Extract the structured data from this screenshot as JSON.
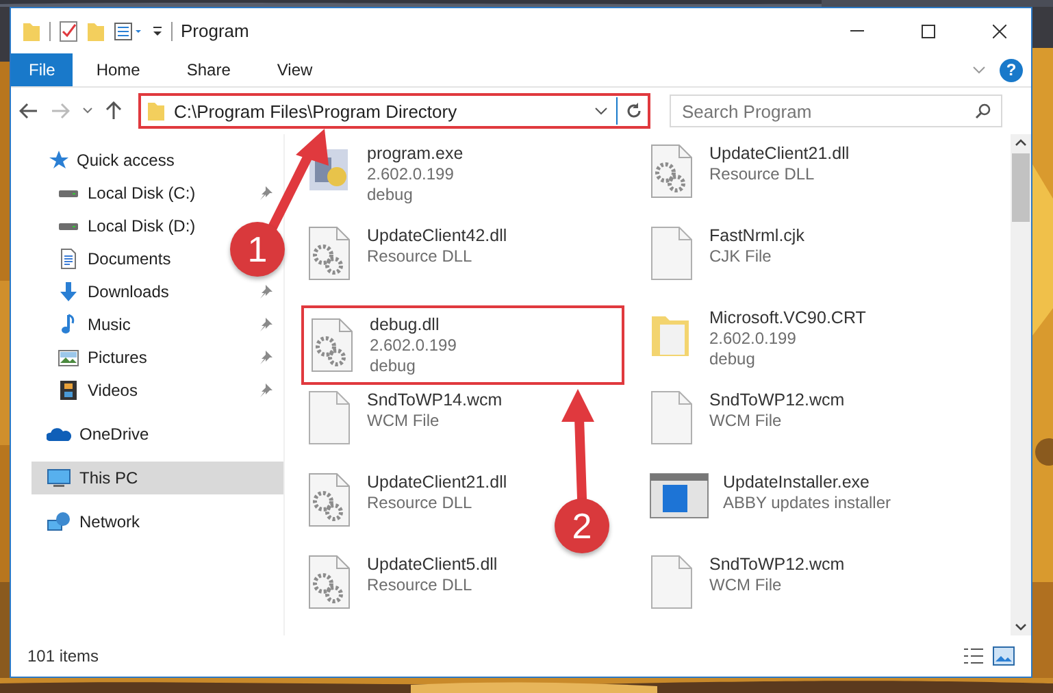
{
  "window": {
    "title": "Program"
  },
  "ribbon_tabs": [
    {
      "label": "File",
      "selected": true
    },
    {
      "label": "Home",
      "selected": false
    },
    {
      "label": "Share",
      "selected": false
    },
    {
      "label": "View",
      "selected": false
    }
  ],
  "help_button": "?",
  "address": {
    "path": "C:\\Program Files\\Program Directory",
    "highlighted": true
  },
  "search": {
    "placeholder": "Search Program"
  },
  "sidebar": {
    "items": [
      {
        "label": "Quick access",
        "kind": "star",
        "selected": false,
        "children": [
          {
            "label": "Local Disk (C:)",
            "kind": "drive",
            "pinned": true,
            "selected": false
          },
          {
            "label": "Local Disk (D:)",
            "kind": "drive",
            "pinned": false,
            "selected": false
          },
          {
            "label": "Documents",
            "kind": "documents",
            "pinned": false,
            "selected": false
          },
          {
            "label": "Downloads",
            "kind": "downloads",
            "pinned": true,
            "selected": false
          },
          {
            "label": "Music",
            "kind": "music",
            "pinned": true,
            "selected": false
          },
          {
            "label": "Pictures",
            "kind": "pictures",
            "pinned": true,
            "selected": false
          },
          {
            "label": "Videos",
            "kind": "videos",
            "pinned": true,
            "selected": false
          }
        ]
      },
      {
        "label": "OneDrive",
        "kind": "cloud",
        "selected": false
      },
      {
        "label": "This PC",
        "kind": "pc",
        "selected": true
      },
      {
        "label": "Network",
        "kind": "network",
        "selected": false
      }
    ]
  },
  "files": [
    {
      "name": "program.exe",
      "lines": [
        "2.602.0.199",
        "debug"
      ],
      "kind": "exe",
      "highlighted": false
    },
    {
      "name": "UpdateClient21.dll",
      "lines": [
        "Resource DLL"
      ],
      "kind": "dll",
      "highlighted": false
    },
    {
      "name": "UpdateClient42.dll",
      "lines": [
        "Resource DLL"
      ],
      "kind": "dll",
      "highlighted": false
    },
    {
      "name": "FastNrml.cjk",
      "lines": [
        "CJK File"
      ],
      "kind": "file",
      "highlighted": false
    },
    {
      "name": "debug.dll",
      "lines": [
        "2.602.0.199",
        "debug"
      ],
      "kind": "dll",
      "highlighted": true
    },
    {
      "name": "Microsoft.VC90.CRT",
      "lines": [
        "2.602.0.199",
        "debug"
      ],
      "kind": "folder",
      "highlighted": false
    },
    {
      "name": "SndToWP14.wcm",
      "lines": [
        "WCM File"
      ],
      "kind": "file",
      "highlighted": false
    },
    {
      "name": "SndToWP12.wcm",
      "lines": [
        "WCM File"
      ],
      "kind": "file",
      "highlighted": false
    },
    {
      "name": "UpdateClient21.dll",
      "lines": [
        "Resource DLL"
      ],
      "kind": "dll",
      "highlighted": false
    },
    {
      "name": "UpdateInstaller.exe",
      "lines": [
        "ABBY updates installer"
      ],
      "kind": "installer",
      "highlighted": false
    },
    {
      "name": "UpdateClient5.dll",
      "lines": [
        "Resource DLL"
      ],
      "kind": "dll",
      "highlighted": false
    },
    {
      "name": "SndToWP12.wcm",
      "lines": [
        "WCM File"
      ],
      "kind": "file",
      "highlighted": false
    }
  ],
  "status_bar": {
    "text": "101 items"
  },
  "annotations": [
    {
      "label": "1"
    },
    {
      "label": "2"
    }
  ]
}
